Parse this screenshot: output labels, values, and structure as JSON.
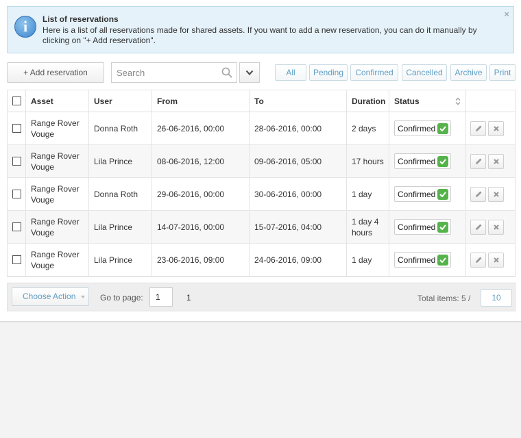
{
  "info": {
    "title": "List of reservations",
    "text": "Here is a list of all reservations made for shared assets. If you want to add a new reservation, you can do it manually by clicking on \"+ Add reservation\".",
    "close_glyph": "×"
  },
  "toolbar": {
    "add_label": "+ Add reservation",
    "search_placeholder": "Search"
  },
  "filters": [
    "All",
    "Pending",
    "Confirmed",
    "Cancelled",
    "Archive",
    "Print"
  ],
  "table": {
    "headers": {
      "asset": "Asset",
      "user": "User",
      "from": "From",
      "to": "To",
      "duration": "Duration",
      "status": "Status"
    },
    "rows": [
      {
        "asset": "Range Rover Vouge",
        "user": "Donna Roth",
        "from": "26-06-2016, 00:00",
        "to": "28-06-2016, 00:00",
        "duration": "2 days",
        "status": "Confirmed"
      },
      {
        "asset": "Range Rover Vouge",
        "user": "Lila Prince",
        "from": "08-06-2016, 12:00",
        "to": "09-06-2016, 05:00",
        "duration": "17 hours",
        "status": "Confirmed"
      },
      {
        "asset": "Range Rover Vouge",
        "user": "Donna Roth",
        "from": "29-06-2016, 00:00",
        "to": "30-06-2016, 00:00",
        "duration": "1 day",
        "status": "Confirmed"
      },
      {
        "asset": "Range Rover Vouge",
        "user": "Lila Prince",
        "from": "14-07-2016, 00:00",
        "to": "15-07-2016, 04:00",
        "duration": "1 day 4 hours",
        "status": "Confirmed"
      },
      {
        "asset": "Range Rover Vouge",
        "user": "Lila Prince",
        "from": "23-06-2016, 09:00",
        "to": "24-06-2016, 09:00",
        "duration": "1 day",
        "status": "Confirmed"
      }
    ]
  },
  "footer": {
    "choose_action": "Choose Action",
    "goto_label": "Go to page:",
    "goto_value": "1",
    "page_number": "1",
    "total_label": "Total items: 5 /",
    "per_page": "10"
  },
  "colors": {
    "accent": "#5e9ec4",
    "confirmed": "#56b34c",
    "info_bg": "#e5f2f9"
  }
}
